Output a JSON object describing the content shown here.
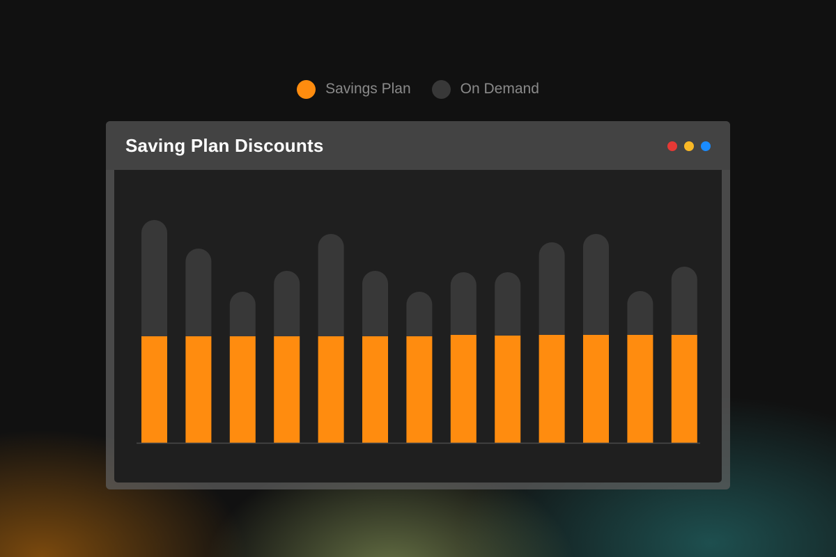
{
  "legend": {
    "items": [
      {
        "label": "Savings Plan",
        "color": "#ff8c0f"
      },
      {
        "label": "On Demand",
        "color": "#383838"
      }
    ]
  },
  "window": {
    "title": "Saving Plan Discounts",
    "controls": [
      {
        "name": "close-dot",
        "color": "#e53935"
      },
      {
        "name": "minimize-dot",
        "color": "#f9b826"
      },
      {
        "name": "maximize-dot",
        "color": "#1a8cff"
      }
    ]
  },
  "chart_data": {
    "type": "bar",
    "stacked": true,
    "grid": false,
    "categories": [
      "",
      "",
      "",
      "",
      "",
      "",
      "",
      "",
      "",
      "",
      "",
      "",
      ""
    ],
    "series": [
      {
        "name": "Savings Plan",
        "color": "#ff8c0f",
        "values": [
          153,
          153,
          153,
          153,
          153,
          153,
          153,
          155,
          154,
          155,
          155,
          155,
          155
        ]
      },
      {
        "name": "On Demand",
        "color": "#383838",
        "values": [
          167,
          126,
          64,
          94,
          147,
          94,
          64,
          90,
          91,
          133,
          145,
          63,
          98
        ]
      }
    ],
    "ylim": [
      0,
      330
    ]
  }
}
